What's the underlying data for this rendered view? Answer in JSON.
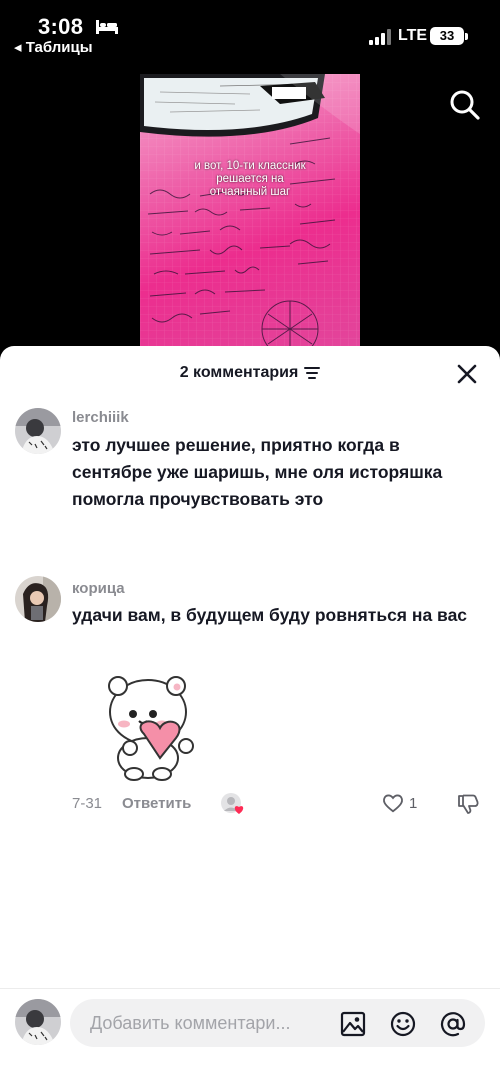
{
  "status_bar": {
    "time": "3:08",
    "back_label": "◂ Таблицы",
    "network": "LTE",
    "battery": "33"
  },
  "video": {
    "caption": "и вот, 10-ти классник решается на отчаянный шаг"
  },
  "sheet": {
    "title": "2 комментария"
  },
  "comments": [
    {
      "username": "lerchiiik",
      "text": "это лучшее решение, приятно когда в сентябре уже шаришь, мне оля исторяшка помогла прочувствовать это"
    },
    {
      "username": "корица",
      "text": "удачи вам, в будущем буду ровняться на вас",
      "date": "7-31",
      "reply_label": "Ответить",
      "like_count": "1"
    }
  ],
  "input": {
    "placeholder": "Добавить комментари..."
  },
  "colors": {
    "accent_red": "#fe2c55",
    "text_primary": "#161823",
    "text_secondary": "#8a8b91"
  }
}
